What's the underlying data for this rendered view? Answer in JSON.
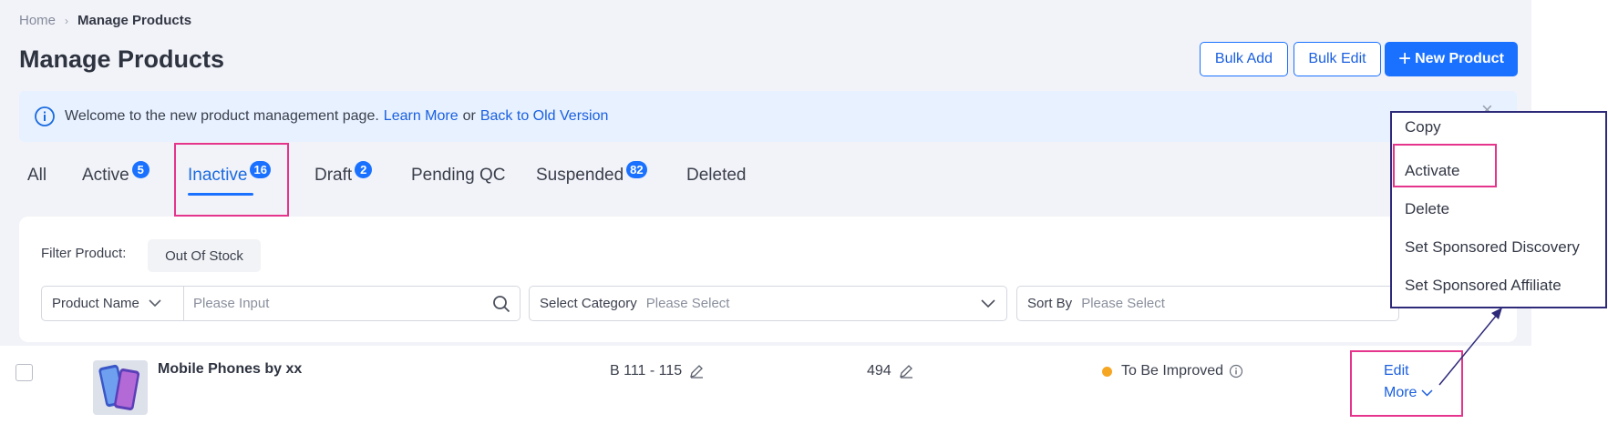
{
  "breadcrumb": {
    "home": "Home",
    "separator": "›",
    "current": "Manage Products"
  },
  "page": {
    "title": "Manage Products"
  },
  "header_buttons": {
    "bulk_add": "Bulk Add",
    "bulk_edit": "Bulk Edit",
    "new_product_plus": "+",
    "new_product": "New Product"
  },
  "notice": {
    "icon": "info-circle-icon",
    "text": "Welcome to the new product management page.",
    "learn_more": "Learn More",
    "or": "or",
    "back_old": "Back to Old Version",
    "close": "×"
  },
  "tabs": [
    {
      "label": "All",
      "badge": null
    },
    {
      "label": "Active",
      "badge": "5"
    },
    {
      "label": "Inactive",
      "badge": "16",
      "active": true
    },
    {
      "label": "Draft",
      "badge": "2"
    },
    {
      "label": "Pending QC",
      "badge": null
    },
    {
      "label": "Suspended",
      "badge": "82"
    },
    {
      "label": "Deleted",
      "badge": null
    }
  ],
  "filter": {
    "label": "Filter Product:",
    "chip": "Out Of Stock",
    "search_type": "Product Name",
    "search_placeholder": "Please Input",
    "category_label": "Select Category",
    "category_placeholder": "Please Select",
    "sort_label": "Sort By",
    "sort_placeholder": "Please Select"
  },
  "product_row": {
    "name": "Mobile Phones by xx",
    "price": "B 111 - 115",
    "stock": "494",
    "status": "To Be Improved",
    "edit": "Edit",
    "more": "More"
  },
  "more_menu": {
    "items": [
      "Copy",
      "Activate",
      "Delete",
      "Set Sponsored Discovery",
      "Set Sponsored Affiliate"
    ]
  },
  "colors": {
    "primary": "#1a71ff",
    "highlight": "#e5348c",
    "annotation": "#2e2a7a",
    "status_warning": "#f5a623",
    "notice_bg": "#e7f1ff"
  }
}
